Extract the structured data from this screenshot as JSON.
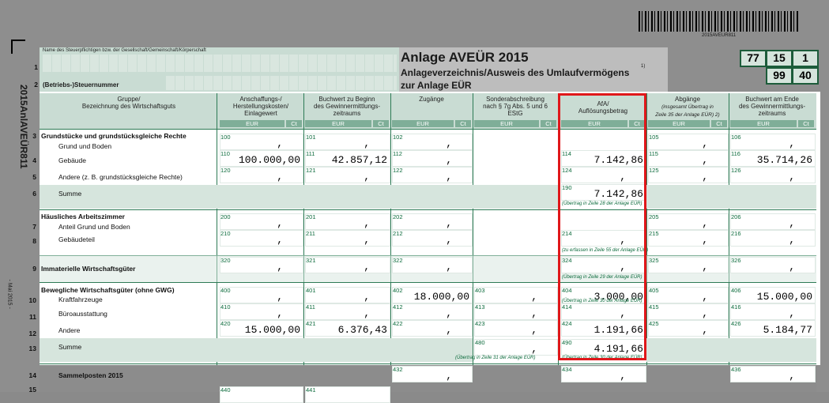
{
  "header": {
    "barcode_number": "2015AVEUR811",
    "form_id": "2015AnlAVEÜR811",
    "form_date": "- Mai 2015 -",
    "name_label": "Name des Steuerpflichtigen bzw. der Gesellschaft/Gemeinschaft/Körperschaft",
    "row1": "1",
    "row2": "2",
    "tax_number_label": "(Betriebs-)Steuernummer",
    "title": "Anlage AVEÜR 2015",
    "subtitle": "Anlageverzeichnis/Ausweis des Umlaufvermögens",
    "footnote": "1)",
    "subtitle2": "zur Anlage EÜR",
    "codes": [
      "77",
      "15",
      "1",
      "99",
      "40"
    ]
  },
  "columns": [
    {
      "line1": "Gruppe/",
      "line2": "Bezeichnung des Wirtschaftsguts"
    },
    {
      "line1": "Anschaffungs-/",
      "line2": "Herstellungskosten/",
      "line3": "Einlagewert",
      "eur": "EUR",
      "ct": "Ct"
    },
    {
      "line1": "Buchwert zu Beginn",
      "line2": "des Gewinnermittlungs-",
      "line3": "zeitraums",
      "eur": "EUR",
      "ct": "Ct"
    },
    {
      "line1": "Zugänge",
      "eur": "EUR",
      "ct": "Ct"
    },
    {
      "line1": "Sonderabschreibung",
      "line2": "nach § 7g Abs. 5 und 6",
      "line3": "EStG",
      "eur": "EUR",
      "ct": "Ct"
    },
    {
      "line1": "AfA/",
      "line2": "Auflösungsbetrag",
      "eur": "EUR",
      "ct": "Ct"
    },
    {
      "line1": "Abgänge",
      "line2": "(insgesamt Übertrag in",
      "line3": "Zeile 35 der Anlage EÜR) 2)",
      "eur": "EUR",
      "ct": "Ct"
    },
    {
      "line1": "Buchwert am Ende",
      "line2": "des Gewinnermittlungs-",
      "line3": "zeitraums",
      "eur": "EUR",
      "ct": "Ct"
    }
  ],
  "rows": {
    "sec1": "Grundstücke und grundstücksgleiche Rechte",
    "r3": "Grund und Boden",
    "r4": "Gebäude",
    "r5": "Andere (z. B. grundstücksgleiche Rechte)",
    "r6": "Summe",
    "sec2": "Häusliches Arbeitszimmer",
    "r7": "Anteil Grund und Boden",
    "r8": "Gebäudeteil",
    "sec3": "Immaterielle Wirtschaftsgüter",
    "sec4": "Bewegliche Wirtschaftsgüter (ohne GWG)",
    "r10": "Kraftfahrzeuge",
    "r11": "Büroausstattung",
    "r12": "Andere",
    "r13": "Summe",
    "r14": "Sammelposten 2015"
  },
  "rownums": {
    "3": "3",
    "4": "4",
    "5": "5",
    "6": "6",
    "7": "7",
    "8": "8",
    "9": "9",
    "10": "10",
    "11": "11",
    "12": "12",
    "13": "13",
    "14": "14",
    "15": "15"
  },
  "notes": {
    "n190": "(Übertrag in Zeile 28 der Anlage EÜR)",
    "n214": "(zu erfassen in Zeile 55 der Anlage EÜR)",
    "n324": "(Übertrag in Zeile 29 der Anlage EÜR)",
    "n404": "(Übertrag in Zeile 30 der Anlage EÜR)",
    "n480": "(Übertrag in Zeile 31 der Anlage EÜR)",
    "n490": "(Übertrag in Zeile 30 der Anlage EÜR)"
  },
  "fields": [
    {
      "code": "100",
      "value": ",",
      "col": 0,
      "row": 0
    },
    {
      "code": "101",
      "value": ",",
      "col": 1,
      "row": 0
    },
    {
      "code": "102",
      "value": ",",
      "col": 2,
      "row": 0
    },
    {
      "code": "105",
      "value": ",",
      "col": 5,
      "row": 0
    },
    {
      "code": "106",
      "value": ",",
      "col": 6,
      "row": 0
    },
    {
      "code": "110",
      "value": "100.000,00",
      "col": 0,
      "row": 1
    },
    {
      "code": "111",
      "value": "42.857,12",
      "col": 1,
      "row": 1
    },
    {
      "code": "112",
      "value": ",",
      "col": 2,
      "row": 1
    },
    {
      "code": "114",
      "value": "7.142,86",
      "col": 4,
      "row": 1
    },
    {
      "code": "115",
      "value": ",",
      "col": 5,
      "row": 1
    },
    {
      "code": "116",
      "value": "35.714,26",
      "col": 6,
      "row": 1
    },
    {
      "code": "120",
      "value": ",",
      "col": 0,
      "row": 2
    },
    {
      "code": "121",
      "value": ",",
      "col": 1,
      "row": 2
    },
    {
      "code": "122",
      "value": ",",
      "col": 2,
      "row": 2
    },
    {
      "code": "124",
      "value": ",",
      "col": 4,
      "row": 2
    },
    {
      "code": "125",
      "value": ",",
      "col": 5,
      "row": 2
    },
    {
      "code": "126",
      "value": ",",
      "col": 6,
      "row": 2
    },
    {
      "code": "190",
      "value": "7.142,86",
      "col": 4,
      "row": 3
    },
    {
      "code": "200",
      "value": ",",
      "col": 0,
      "row": 4
    },
    {
      "code": "201",
      "value": ",",
      "col": 1,
      "row": 4
    },
    {
      "code": "202",
      "value": ",",
      "col": 2,
      "row": 4
    },
    {
      "code": "205",
      "value": ",",
      "col": 5,
      "row": 4
    },
    {
      "code": "206",
      "value": ",",
      "col": 6,
      "row": 4
    },
    {
      "code": "210",
      "value": ",",
      "col": 0,
      "row": 5
    },
    {
      "code": "211",
      "value": ",",
      "col": 1,
      "row": 5
    },
    {
      "code": "212",
      "value": ",",
      "col": 2,
      "row": 5
    },
    {
      "code": "214",
      "value": ",",
      "col": 4,
      "row": 5
    },
    {
      "code": "215",
      "value": ",",
      "col": 5,
      "row": 5
    },
    {
      "code": "216",
      "value": ",",
      "col": 6,
      "row": 5
    },
    {
      "code": "320",
      "value": ",",
      "col": 0,
      "row": 6
    },
    {
      "code": "321",
      "value": ",",
      "col": 1,
      "row": 6
    },
    {
      "code": "322",
      "value": ",",
      "col": 2,
      "row": 6
    },
    {
      "code": "324",
      "value": ",",
      "col": 4,
      "row": 6
    },
    {
      "code": "325",
      "value": ",",
      "col": 5,
      "row": 6
    },
    {
      "code": "326",
      "value": ",",
      "col": 6,
      "row": 6
    },
    {
      "code": "400",
      "value": ",",
      "col": 0,
      "row": 7
    },
    {
      "code": "401",
      "value": ",",
      "col": 1,
      "row": 7
    },
    {
      "code": "402",
      "value": "18.000,00",
      "col": 2,
      "row": 7
    },
    {
      "code": "403",
      "value": ",",
      "col": 3,
      "row": 7
    },
    {
      "code": "404",
      "value": "3.000,00",
      "col": 4,
      "row": 7
    },
    {
      "code": "405",
      "value": ",",
      "col": 5,
      "row": 7
    },
    {
      "code": "406",
      "value": "15.000,00",
      "col": 6,
      "row": 7
    },
    {
      "code": "410",
      "value": ",",
      "col": 0,
      "row": 8
    },
    {
      "code": "411",
      "value": ",",
      "col": 1,
      "row": 8
    },
    {
      "code": "412",
      "value": ",",
      "col": 2,
      "row": 8
    },
    {
      "code": "413",
      "value": ",",
      "col": 3,
      "row": 8
    },
    {
      "code": "414",
      "value": ",",
      "col": 4,
      "row": 8
    },
    {
      "code": "415",
      "value": ",",
      "col": 5,
      "row": 8
    },
    {
      "code": "416",
      "value": ",",
      "col": 6,
      "row": 8
    },
    {
      "code": "420",
      "value": "15.000,00",
      "col": 0,
      "row": 9
    },
    {
      "code": "421",
      "value": "6.376,43",
      "col": 1,
      "row": 9
    },
    {
      "code": "422",
      "value": ",",
      "col": 2,
      "row": 9
    },
    {
      "code": "423",
      "value": ",",
      "col": 3,
      "row": 9
    },
    {
      "code": "424",
      "value": "1.191,66",
      "col": 4,
      "row": 9
    },
    {
      "code": "425",
      "value": ",",
      "col": 5,
      "row": 9
    },
    {
      "code": "426",
      "value": "5.184,77",
      "col": 6,
      "row": 9
    },
    {
      "code": "480",
      "value": ",",
      "col": 3,
      "row": 10
    },
    {
      "code": "490",
      "value": "4.191,66",
      "col": 4,
      "row": 10
    },
    {
      "code": "432",
      "value": ",",
      "col": 2,
      "row": 11
    },
    {
      "code": "434",
      "value": ",",
      "col": 4,
      "row": 11
    },
    {
      "code": "436",
      "value": ",",
      "col": 6,
      "row": 11
    },
    {
      "code": "440",
      "value": "",
      "col": 0,
      "row": 12
    },
    {
      "code": "441",
      "value": "",
      "col": 1,
      "row": 12
    }
  ]
}
